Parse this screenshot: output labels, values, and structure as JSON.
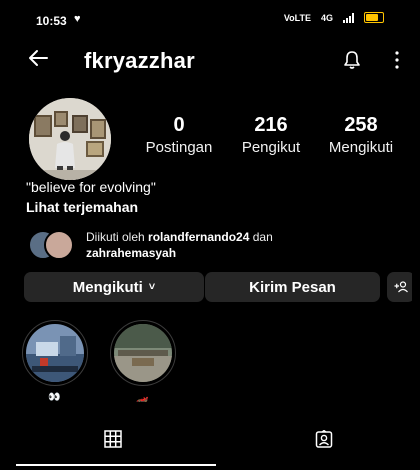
{
  "status_bar": {
    "time": "10:53",
    "notification_icon": "heart-shield-icon",
    "network_label": "VoLTE",
    "signal_label": "4G"
  },
  "header": {
    "username": "fkryazzhar",
    "back_icon": "arrow-left-icon",
    "bell_icon": "bell-icon",
    "more_icon": "kebab-menu-icon"
  },
  "stats": [
    {
      "value": "0",
      "label": "Postingan"
    },
    {
      "value": "216",
      "label": "Pengikut"
    },
    {
      "value": "258",
      "label": "Mengikuti"
    }
  ],
  "bio": {
    "text": "\"believe for evolving\"",
    "translate": "Lihat terjemahan"
  },
  "followed_by": {
    "prefix": "Diikuti oleh",
    "user1": "rolandfernando24",
    "connector": "dan",
    "user2": "zahrahemasyah"
  },
  "buttons": {
    "following": "Mengikuti",
    "following_chevron": "˅",
    "message": "Kirim Pesan",
    "add_user_icon": "add-person-icon"
  },
  "highlights": [
    {
      "label": "👀"
    },
    {
      "label": "🏎️"
    }
  ],
  "tabs": {
    "grid_icon": "grid-icon",
    "tagged_icon": "tagged-person-icon"
  },
  "colors": {
    "background": "#000000",
    "button": "#262626",
    "battery": "#ffc400"
  }
}
